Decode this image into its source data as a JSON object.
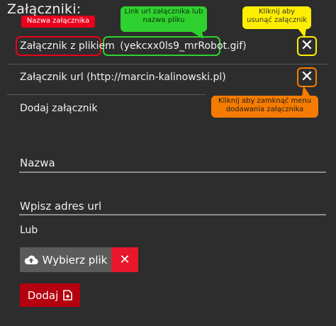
{
  "heading": "Załączniki:",
  "attachments": [
    {
      "prefix": "Załącznik z plikiem",
      "file": "(yekcxx0ls9_mrRobot.gif)"
    },
    {
      "label": "Załącznik url (http://marcin-kalinowski.pl)"
    }
  ],
  "add_section_label": "Dodaj załącznik",
  "form": {
    "name_placeholder": "Nazwa",
    "url_placeholder": "Wpisz adres url",
    "or_label": "Lub",
    "choose_file_label": "Wybierz plik",
    "add_label": "Dodaj"
  },
  "annotations": {
    "name_label": "Nazwa załącznika",
    "link_label": "Link url załącznika lub nazwa pliku",
    "remove_label": "Kliknij aby usunąć załącznik",
    "close_label": "Kliknij aby zamknąć menu dodawania załącznika"
  },
  "colors": {
    "background": "#2d2d2d",
    "name_annotation": "#e8001c",
    "link_annotation": "#2ed12e",
    "remove_annotation": "#ffee00",
    "close_annotation": "#f57c00",
    "clear_button": "#e8172b",
    "add_button": "#b4000f"
  },
  "icons": {
    "remove": "close-icon",
    "close_menu": "close-icon",
    "upload": "cloud-upload-icon",
    "clear": "close-icon",
    "add": "file-plus-icon"
  }
}
